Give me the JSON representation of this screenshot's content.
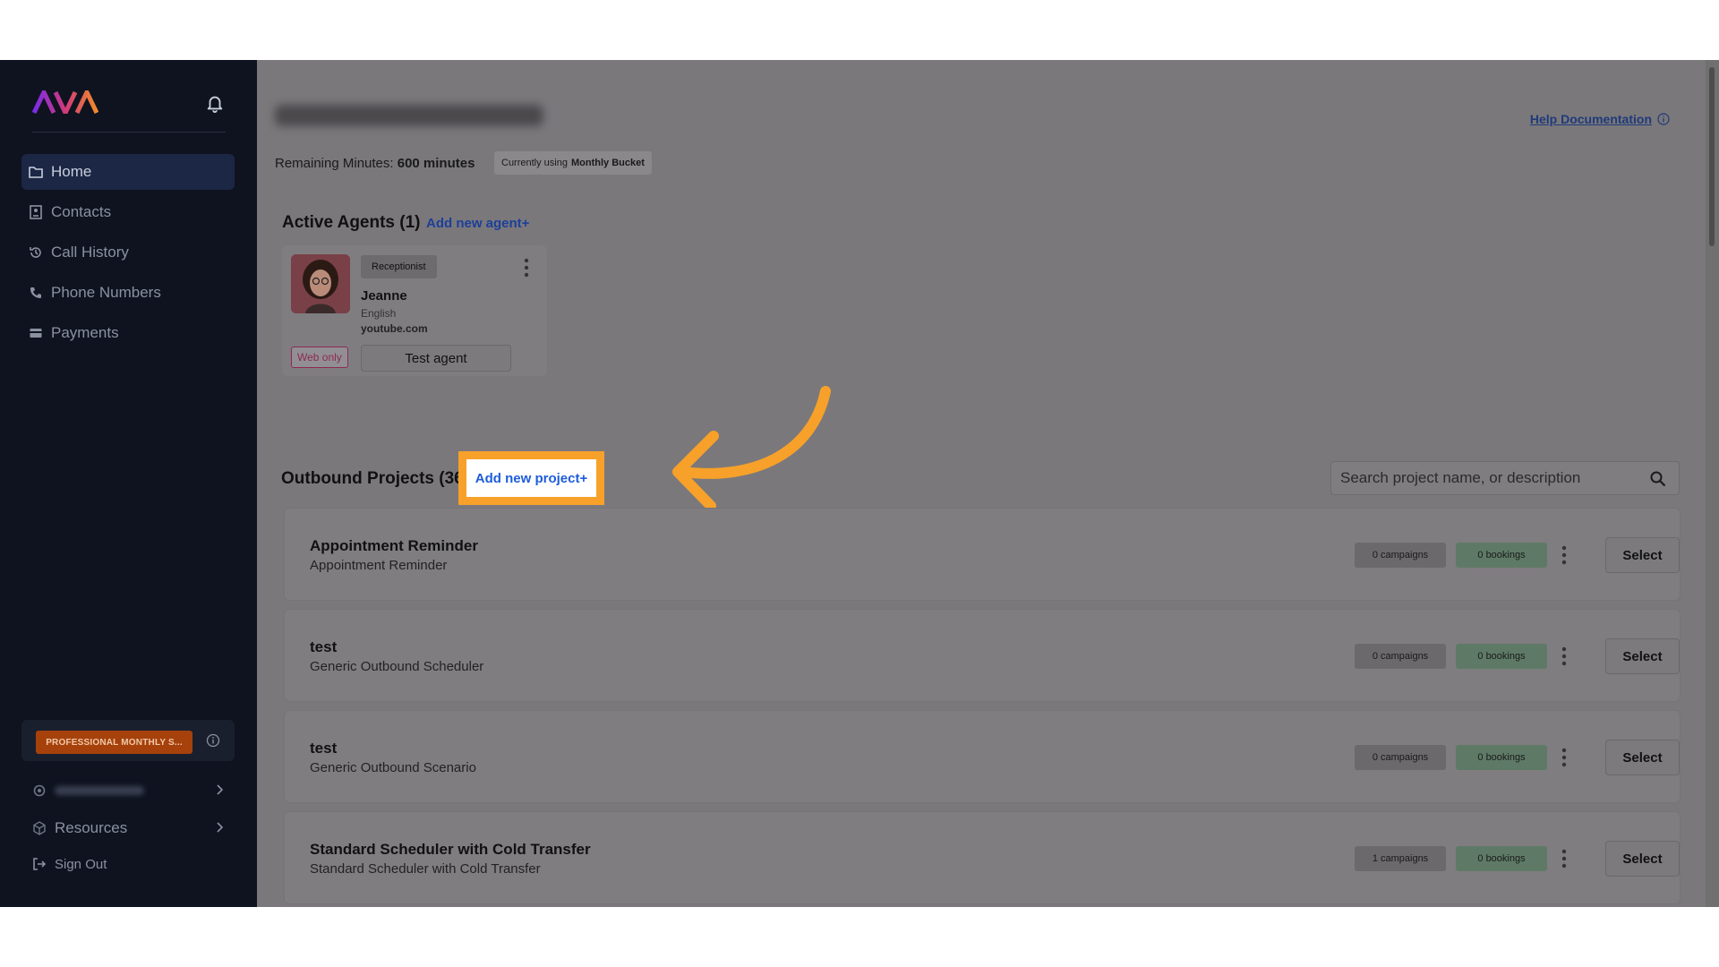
{
  "app": {
    "logo_text": "AVA"
  },
  "sidebar": {
    "items": [
      {
        "label": "Home",
        "icon": "folder-icon",
        "active": true
      },
      {
        "label": "Contacts",
        "icon": "contact-card-icon",
        "active": false
      },
      {
        "label": "Call History",
        "icon": "history-icon",
        "active": false
      },
      {
        "label": "Phone Numbers",
        "icon": "phone-icon",
        "active": false
      },
      {
        "label": "Payments",
        "icon": "card-icon",
        "active": false
      }
    ],
    "plan_label": "PROFESSIONAL MONTHLY S...",
    "resources_label": "Resources",
    "signout_label": "Sign Out"
  },
  "header": {
    "help_label": "Help Documentation",
    "remaining_prefix": "Remaining Minutes:",
    "remaining_value": "600 minutes",
    "bucket_prefix": "Currently using",
    "bucket_value": "Monthly Bucket"
  },
  "agents": {
    "title": "Active Agents (1)",
    "add_label": "Add new agent+",
    "card": {
      "role": "Receptionist",
      "name": "Jeanne",
      "language": "English",
      "site": "youtube.com",
      "web_only": "Web only",
      "test_label": "Test agent"
    }
  },
  "projects": {
    "title": "Outbound Projects (36",
    "add_label": "Add new project+",
    "search_placeholder": "Search project name, or description",
    "select_label": "Select",
    "rows": [
      {
        "name": "Appointment Reminder",
        "desc": "Appointment Reminder",
        "campaigns": "0 campaigns",
        "bookings": "0 bookings"
      },
      {
        "name": "test",
        "desc": "Generic Outbound Scheduler",
        "campaigns": "0 campaigns",
        "bookings": "0 bookings"
      },
      {
        "name": "test",
        "desc": "Generic Outbound Scenario",
        "campaigns": "0 campaigns",
        "bookings": "0 bookings"
      },
      {
        "name": "Standard Scheduler with Cold Transfer",
        "desc": "Standard Scheduler with Cold Transfer",
        "campaigns": "1 campaigns",
        "bookings": "0 bookings"
      }
    ]
  },
  "colors": {
    "sidebar_bg": "#0f1320",
    "overlay_bg": "#7a787b",
    "highlight": "#f7a12a",
    "plan_badge": "#a6410b"
  }
}
